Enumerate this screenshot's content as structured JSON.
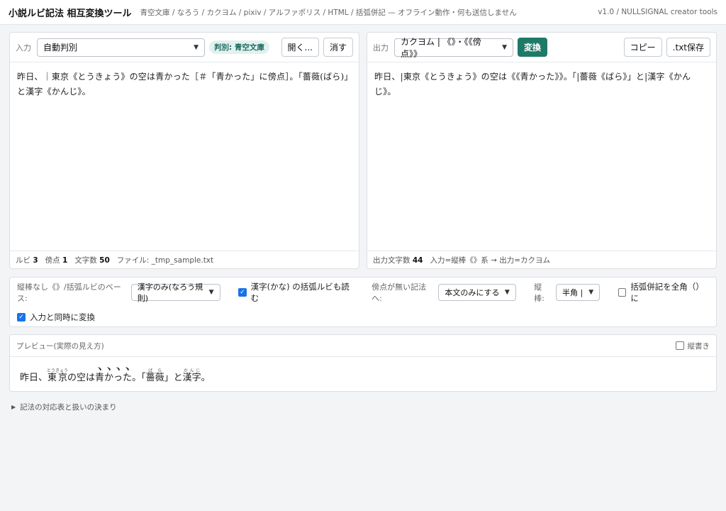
{
  "header": {
    "title": "小説ルビ記法 相互変換ツール",
    "subtitle": "青空文庫 / なろう / カクヨム / pixiv / アルファポリス / HTML / 括弧併記 — オフライン動作・何も送信しません",
    "version": "v1.0 / NULLSIGNAL creator tools"
  },
  "input_pane": {
    "label": "入力",
    "format_select": "自動判別",
    "detected_badge": "判別: 青空文庫",
    "open_button": "開く...",
    "clear_button": "消す",
    "text": "昨日、｜東京《とうきょう》の空は青かった［＃「青かった」に傍点］。「薔薇(ばら)」と漢字《かんじ》。",
    "footer": {
      "ruby_label": "ルビ",
      "ruby_count": "3",
      "boten_label": "傍点",
      "boten_count": "1",
      "chars_label": "文字数",
      "chars_count": "50",
      "file_label": "ファイル:",
      "file_name": "_tmp_sample.txt"
    }
  },
  "output_pane": {
    "label": "出力",
    "format_select": "カクヨム | 《》・《《傍点》》",
    "convert_button": "変換",
    "copy_button": "コピー",
    "save_button": ".txt保存",
    "text": "昨日、|東京《とうきょう》の空は《《青かった》》。「|薔薇《ばら》」と|漢字《かんじ》。",
    "footer": {
      "chars_label": "出力文字数",
      "chars_count": "44",
      "note": "入力=縦棒《》系 → 出力=カクヨム"
    }
  },
  "options": {
    "base_label": "縦棒なし《》/括弧ルビのベース:",
    "base_select": "漢字のみ(なろう規則)",
    "read_paren_label": "漢字(かな) の括弧ルビも読む",
    "read_paren_checked": true,
    "no_boten_label": "傍点が無い記法へ:",
    "no_boten_select": "本文のみにする",
    "bar_label": "縦棒:",
    "bar_select": "半角 |",
    "fullwidth_paren_label": "括弧併記を全角（）に",
    "fullwidth_paren_checked": false,
    "live_convert_label": "入力と同時に変換",
    "live_convert_checked": true
  },
  "preview": {
    "title": "プレビュー(実際の見え方)",
    "vertical_label": "縦書き",
    "vertical_checked": false,
    "seg1": "昨日、",
    "ruby1_base": "東京",
    "ruby1_rt": "とうきょう",
    "seg2": "の空は",
    "boten_text": "青かった",
    "seg3": "。「",
    "ruby2_base": "薔薇",
    "ruby2_rt": "ばら",
    "seg4": "」と",
    "ruby3_base": "漢字",
    "ruby3_rt": "かんじ",
    "seg5": "。"
  },
  "details": {
    "summary": "記法の対応表と扱いの決まり"
  },
  "colors": {
    "accent": "#1d7a67",
    "badge_bg": "#e3f1ee",
    "checkbox": "#1a73e8"
  }
}
